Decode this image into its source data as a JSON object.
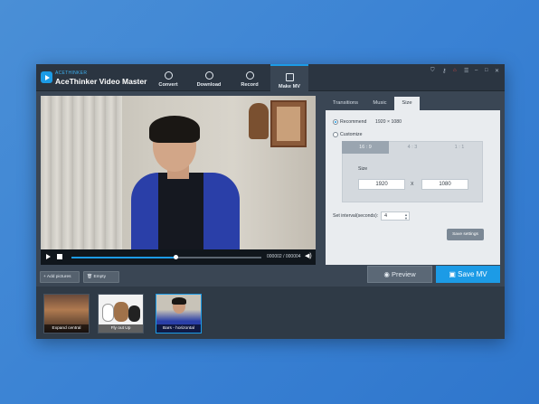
{
  "app": {
    "brand_small": "ACETHINKER",
    "title": "AceThinker Video Master"
  },
  "nav": [
    {
      "label": "Convert",
      "icon": "convert-icon"
    },
    {
      "label": "Download",
      "icon": "download-icon"
    },
    {
      "label": "Record",
      "icon": "record-icon"
    },
    {
      "label": "Make MV",
      "icon": "make-mv-icon",
      "active": true
    }
  ],
  "window_controls": [
    "cart-icon",
    "key-icon",
    "gift-icon",
    "settings-icon",
    "minimize-icon",
    "maximize-icon",
    "close-icon"
  ],
  "player": {
    "timecode": "000002 / 000004",
    "progress": 0.55
  },
  "tabs": [
    {
      "label": "Transitions"
    },
    {
      "label": "Music"
    },
    {
      "label": "Size",
      "active": true
    }
  ],
  "size_panel": {
    "recommend_label": "Recommend",
    "recommend_value": "1920 × 1080",
    "customize_label": "Customize",
    "ratios": [
      "16 : 9",
      "4 : 3",
      "1 : 1"
    ],
    "size_label": "Size",
    "width": "1920",
    "x_sep": "X",
    "height": "1080",
    "interval_label": "Set interval(seconds):",
    "interval_value": "4",
    "save_settings": "Save settings"
  },
  "actions": {
    "preview": "Preview",
    "save_mv": "Save MV",
    "add_pictures": "Add pictures",
    "empty": "Empty"
  },
  "thumbnails": [
    {
      "caption": "Expand central"
    },
    {
      "caption": "Fly out Up"
    },
    {
      "caption": "Bars - horizontal",
      "selected": true
    }
  ],
  "colors": {
    "accent": "#1c9be6",
    "window_bg": "#3a4654",
    "titlebar_bg": "#2b3541"
  }
}
